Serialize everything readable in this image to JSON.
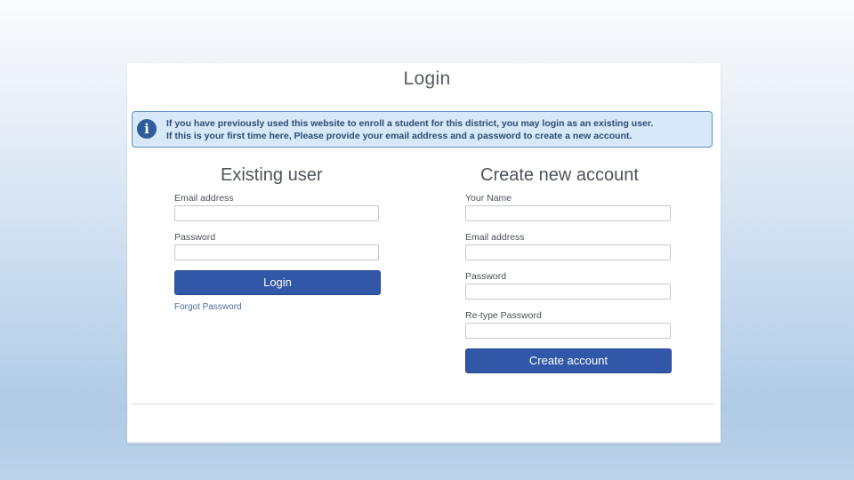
{
  "title": "Login",
  "info": {
    "icon": "info-icon",
    "line1": "If you have previously used this website to enroll a student for this district, you may login as an existing user.",
    "line2": "If this is your first time here, Please provide your email address and a password to create a new account."
  },
  "existing": {
    "heading": "Existing user",
    "email_label": "Email address",
    "email_value": "",
    "password_label": "Password",
    "password_value": "",
    "login_button": "Login",
    "forgot_link": "Forgot Password"
  },
  "create": {
    "heading": "Create new account",
    "name_label": "Your Name",
    "name_value": "",
    "email_label": "Email address",
    "email_value": "",
    "password_label": "Password",
    "password_value": "",
    "retype_label": "Re-type Password",
    "retype_value": "",
    "create_button": "Create account"
  },
  "colors": {
    "primary_button": "#3158a8",
    "info_background": "#d7e9f8",
    "info_border": "#5c8ec4"
  }
}
